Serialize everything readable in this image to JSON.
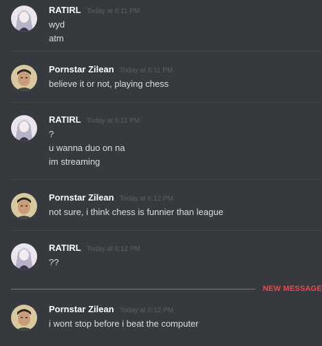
{
  "messages": [
    {
      "username": "RATIRL",
      "timestamp": "Today at 6:11 PM",
      "avatar": "anime-girl-avatar",
      "lines": [
        "wyd",
        "atm"
      ]
    },
    {
      "username": "Pornstar Zilean",
      "timestamp": "Today at 6:11 PM",
      "avatar": "man-face-avatar",
      "lines": [
        "believe it or not, playing chess"
      ]
    },
    {
      "username": "RATIRL",
      "timestamp": "Today at 6:11 PM",
      "avatar": "anime-girl-avatar",
      "lines": [
        "?",
        "u wanna duo on na",
        "im streaming"
      ]
    },
    {
      "username": "Pornstar Zilean",
      "timestamp": "Today at 6:12 PM",
      "avatar": "man-face-avatar",
      "lines": [
        "not sure, i think chess is funnier than league"
      ]
    },
    {
      "username": "RATIRL",
      "timestamp": "Today at 6:12 PM",
      "avatar": "anime-girl-avatar",
      "lines": [
        "??"
      ]
    },
    {
      "username": "Pornstar Zilean",
      "timestamp": "Today at 6:12 PM",
      "avatar": "man-face-avatar",
      "lines": [
        "i wont stop before i beat the computer"
      ]
    }
  ],
  "new_messages_label": "NEW MESSAGES",
  "colors": {
    "background": "#36393e",
    "username": "#ffffff",
    "message_text": "#dcddde",
    "timestamp": "#5c5f64",
    "new_messages": "#f04747"
  }
}
